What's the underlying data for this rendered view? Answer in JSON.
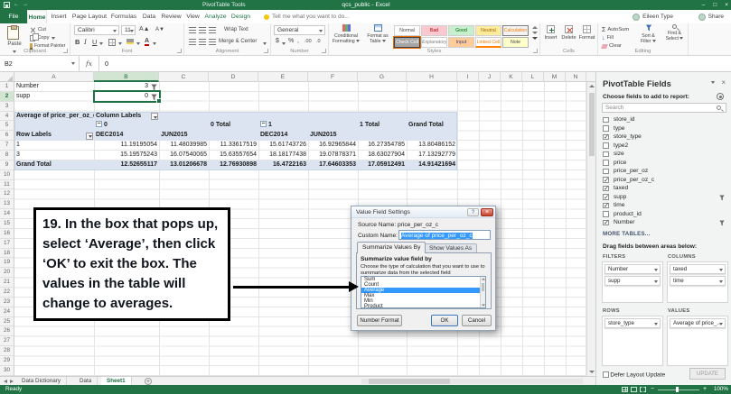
{
  "titlebar": {
    "contextual_title": "PivotTable Tools",
    "document_title": "qcs_public - Excel",
    "minimize": "–",
    "maximize": "□",
    "close": "×"
  },
  "tabs": {
    "file": "File",
    "items": [
      "Home",
      "Insert",
      "Page Layout",
      "Formulas",
      "Data",
      "Review",
      "View",
      "Analyze",
      "Design"
    ],
    "tell_me": "Tell me what you want to do...",
    "user_name": "Eileen Type",
    "share": "Share"
  },
  "ribbon": {
    "clipboard": {
      "paste": "Paste",
      "cut": "Cut",
      "copy": "Copy",
      "format_painter": "Format Painter",
      "label": "Clipboard"
    },
    "font": {
      "name": "Calibri",
      "size": "11",
      "bold": "B",
      "italic": "I",
      "underline": "U",
      "fontcolor": "A",
      "label": "Font"
    },
    "alignment": {
      "wrap_text": "Wrap Text",
      "merge_center": "Merge & Center",
      "label": "Alignment"
    },
    "number": {
      "format": "General",
      "currency": "$",
      "percent": "%",
      "comma": ",",
      "dec1": ".00",
      "dec2": ".0",
      "label": "Number"
    },
    "styles": {
      "conditional": "Conditional Formatting",
      "format_table": "Format as Table",
      "gallery": [
        "Normal",
        "Bad",
        "Good",
        "Neutral",
        "Calculation",
        "Check Cell",
        "Explanatory...",
        "Input",
        "Linked Cell",
        "Note"
      ],
      "label": "Styles"
    },
    "cells": {
      "insert": "Insert",
      "delete": "Delete",
      "format": "Format",
      "label": "Cells"
    },
    "editing": {
      "sigma": "Σ",
      "autosum": "AutoSum",
      "fill": "Fill",
      "clear": "Clear",
      "sort_filter": "Sort & Filter",
      "find_select": "Find & Select",
      "label": "Editing"
    }
  },
  "formula_bar": {
    "name_box": "B2",
    "fx": "fx",
    "content": "0"
  },
  "sheet": {
    "col_letters": [
      "A",
      "B",
      "C",
      "D",
      "E",
      "F",
      "G",
      "H",
      "I",
      "J",
      "K",
      "L",
      "M",
      "N"
    ],
    "row_first": 1,
    "row_last": 30,
    "cells": {
      "a1": "Number",
      "b1": "3",
      "a2": "supp",
      "b2": "0",
      "a4": "Average of price_per_oz_c",
      "b4": "Column Labels",
      "b5_group": "0",
      "d5": "0 Total",
      "e5_group": "1",
      "g5": "1 Total",
      "h5": "Grand Total",
      "a6": "Row Labels",
      "b6": "DEC2014",
      "c6": "JUN2015",
      "e6": "DEC2014",
      "f6": "JUN2015"
    },
    "r7": [
      "1",
      "11.19195054",
      "11.48039985",
      "11.33617519",
      "15.61743726",
      "16.92965844",
      "16.27354785",
      "13.80486152"
    ],
    "r8": [
      "3",
      "15.19575243",
      "16.07540065",
      "15.63557654",
      "18.18177438",
      "19.07878371",
      "18.63027904",
      "17.13292779"
    ],
    "r9": [
      "Grand Total",
      "12.52655117",
      "13.01206678",
      "12.76930898",
      "16.4722163",
      "17.64603353",
      "17.05912491",
      "14.91421694"
    ]
  },
  "annotation": {
    "text": "19. In the box that pops up, select ‘Average’, then click ‘OK’ to exit the box. The values in the table will change to averages."
  },
  "dialog": {
    "title": "Value Field Settings",
    "help": "?",
    "close": "×",
    "source_label": "Source Name:",
    "source_value": "price_per_oz_c",
    "custom_label": "Custom Name:",
    "custom_value": "Average of price_per_oz_c",
    "tab1": "Summarize Values By",
    "tab2": "Show Values As",
    "section_heading": "Summarize value field by",
    "description": "Choose the type of calculation that you want to use to summarize data from the selected field",
    "options": [
      "Sum",
      "Count",
      "Average",
      "Max",
      "Min",
      "Product"
    ],
    "selected_option": "Average",
    "number_format": "Number Format",
    "ok": "OK",
    "cancel": "Cancel"
  },
  "fields_pane": {
    "title": "PivotTable Fields",
    "choose_label": "Choose fields to add to report:",
    "search_placeholder": "Search",
    "fields": [
      {
        "name": "store_id",
        "checked": false
      },
      {
        "name": "type",
        "checked": false
      },
      {
        "name": "store_type",
        "checked": true
      },
      {
        "name": "type2",
        "checked": false
      },
      {
        "name": "size",
        "checked": false
      },
      {
        "name": "price",
        "checked": false
      },
      {
        "name": "price_per_oz",
        "checked": false
      },
      {
        "name": "price_per_oz_c",
        "checked": true
      },
      {
        "name": "taxed",
        "checked": true
      },
      {
        "name": "supp",
        "checked": true
      },
      {
        "name": "time",
        "checked": true
      },
      {
        "name": "product_id",
        "checked": false
      },
      {
        "name": "Number",
        "checked": true
      }
    ],
    "more_tables": "MORE TABLES...",
    "drag_label": "Drag fields between areas below:",
    "filters_label": "FILTERS",
    "columns_label": "COLUMNS",
    "rows_label": "ROWS",
    "values_label": "VALUES",
    "filters": [
      "Number",
      "supp"
    ],
    "columns": [
      "taxed",
      "time"
    ],
    "rows": [
      "store_type"
    ],
    "values": [
      "Average of price_..."
    ],
    "defer_label": "Defer Layout Update",
    "update_button": "UPDATE"
  },
  "sheet_tabs": {
    "tabs": [
      "Data Dictionary",
      "Data",
      "Sheet1"
    ],
    "new_sheet": "+"
  },
  "status_bar": {
    "ready": "Ready",
    "zoom_out": "−",
    "zoom_in": "+",
    "zoom": "100%"
  }
}
